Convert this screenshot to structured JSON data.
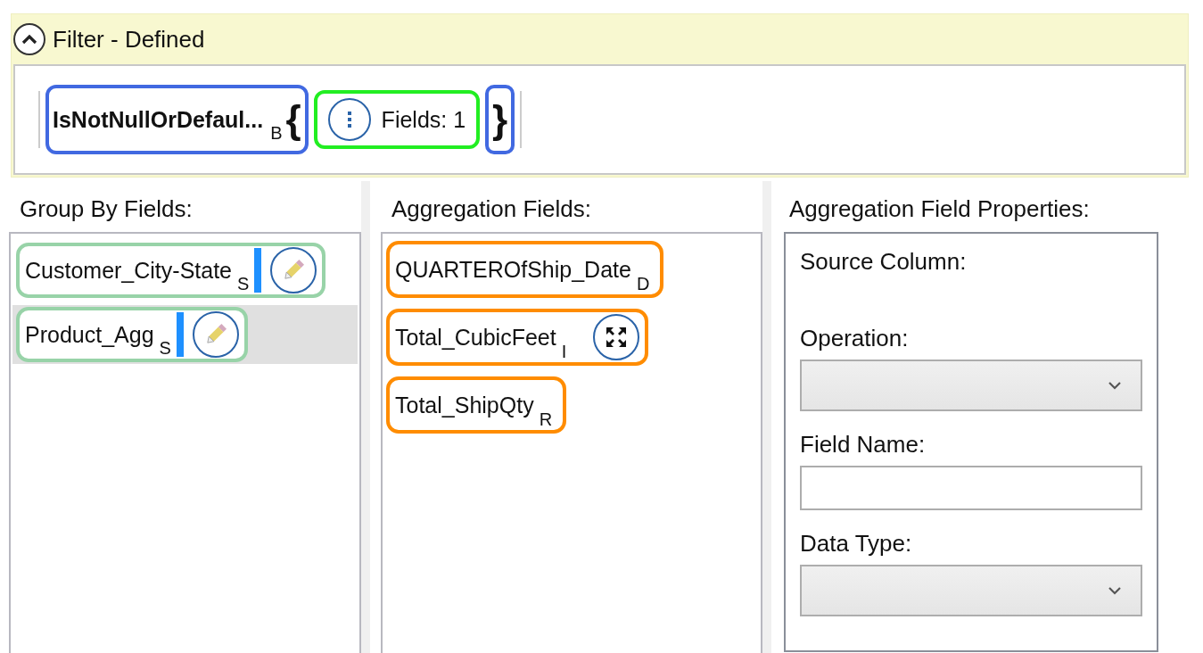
{
  "filter": {
    "title": "Filter - Defined",
    "expanded": true,
    "function": {
      "name": "IsNotNullOrDefaul...",
      "type_code": "B",
      "open_brace": "{"
    },
    "argument": {
      "label": "Fields: 1"
    },
    "close_brace": "}"
  },
  "group_by": {
    "label": "Group By Fields:",
    "items": [
      {
        "name": "Customer_City-State",
        "type_code": "S",
        "selected": false
      },
      {
        "name": "Product_Agg",
        "type_code": "S",
        "selected": true
      }
    ]
  },
  "aggregation": {
    "label": "Aggregation Fields:",
    "items": [
      {
        "name": "QUARTEROfShip_Date",
        "type_code": "D",
        "kind": "plain"
      },
      {
        "name": "Total_CubicFeet",
        "type_code": "I",
        "kind": "expand"
      },
      {
        "name": "Total_ShipQty",
        "type_code": "R",
        "kind": "plain"
      }
    ]
  },
  "properties": {
    "label": "Aggregation Field Properties:",
    "fields": [
      {
        "label": "Source Column:",
        "kind": "text"
      },
      {
        "label": "Operation:",
        "kind": "dropdown"
      },
      {
        "label": "Field Name:",
        "kind": "input"
      },
      {
        "label": "Data Type:",
        "kind": "dropdown"
      }
    ]
  }
}
